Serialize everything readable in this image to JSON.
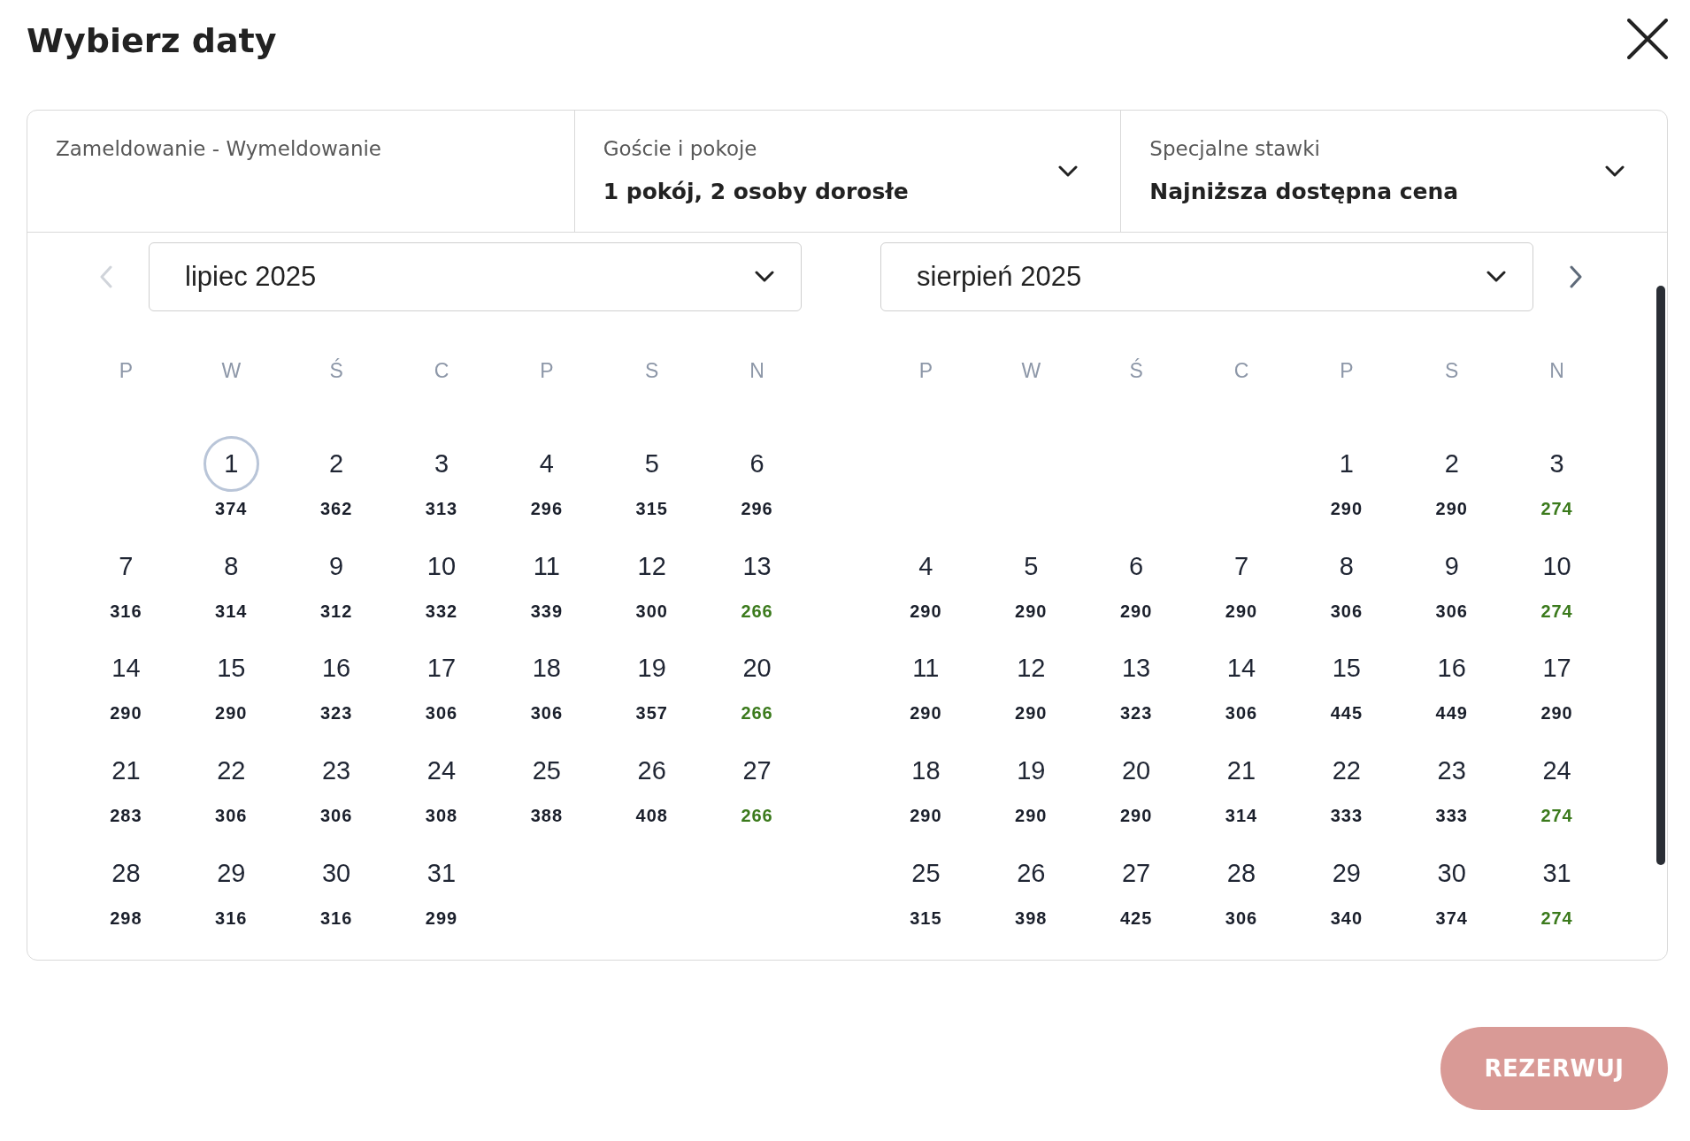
{
  "title": "Wybierz daty",
  "booking_fields": [
    {
      "kind": "text",
      "label": "Zameldowanie - Wymeldowanie"
    },
    {
      "kind": "dropdown",
      "label": "Goście i pokoje",
      "value": "1 pokój, 2 osoby dorosłe"
    },
    {
      "kind": "dropdown",
      "label": "Specjalne stawki",
      "value": "Najniższa dostępna cena"
    }
  ],
  "calendar": {
    "prev_button": {
      "disabled": true
    },
    "next_button": {
      "disabled": false
    },
    "months": [
      {
        "month_select": "lipiec 2025",
        "weekdays": [
          "P",
          "W",
          "Ś",
          "C",
          "P",
          "S",
          "N"
        ],
        "weeks": [
          [
            {
              "kind": "blank"
            },
            {
              "kind": "day",
              "day": "1",
              "price": "374",
              "today": true,
              "cheapest": false
            },
            {
              "kind": "day",
              "day": "2",
              "price": "362",
              "today": false,
              "cheapest": false
            },
            {
              "kind": "day",
              "day": "3",
              "price": "313",
              "today": false,
              "cheapest": false
            },
            {
              "kind": "day",
              "day": "4",
              "price": "296",
              "today": false,
              "cheapest": false
            },
            {
              "kind": "day",
              "day": "5",
              "price": "315",
              "today": false,
              "cheapest": false
            },
            {
              "kind": "day",
              "day": "6",
              "price": "296",
              "today": false,
              "cheapest": false
            }
          ],
          [
            {
              "kind": "day",
              "day": "7",
              "price": "316",
              "today": false,
              "cheapest": false
            },
            {
              "kind": "day",
              "day": "8",
              "price": "314",
              "today": false,
              "cheapest": false
            },
            {
              "kind": "day",
              "day": "9",
              "price": "312",
              "today": false,
              "cheapest": false
            },
            {
              "kind": "day",
              "day": "10",
              "price": "332",
              "today": false,
              "cheapest": false
            },
            {
              "kind": "day",
              "day": "11",
              "price": "339",
              "today": false,
              "cheapest": false
            },
            {
              "kind": "day",
              "day": "12",
              "price": "300",
              "today": false,
              "cheapest": false
            },
            {
              "kind": "day",
              "day": "13",
              "price": "266",
              "today": false,
              "cheapest": true
            }
          ],
          [
            {
              "kind": "day",
              "day": "14",
              "price": "290",
              "today": false,
              "cheapest": false
            },
            {
              "kind": "day",
              "day": "15",
              "price": "290",
              "today": false,
              "cheapest": false
            },
            {
              "kind": "day",
              "day": "16",
              "price": "323",
              "today": false,
              "cheapest": false
            },
            {
              "kind": "day",
              "day": "17",
              "price": "306",
              "today": false,
              "cheapest": false
            },
            {
              "kind": "day",
              "day": "18",
              "price": "306",
              "today": false,
              "cheapest": false
            },
            {
              "kind": "day",
              "day": "19",
              "price": "357",
              "today": false,
              "cheapest": false
            },
            {
              "kind": "day",
              "day": "20",
              "price": "266",
              "today": false,
              "cheapest": true
            }
          ],
          [
            {
              "kind": "day",
              "day": "21",
              "price": "283",
              "today": false,
              "cheapest": false
            },
            {
              "kind": "day",
              "day": "22",
              "price": "306",
              "today": false,
              "cheapest": false
            },
            {
              "kind": "day",
              "day": "23",
              "price": "306",
              "today": false,
              "cheapest": false
            },
            {
              "kind": "day",
              "day": "24",
              "price": "308",
              "today": false,
              "cheapest": false
            },
            {
              "kind": "day",
              "day": "25",
              "price": "388",
              "today": false,
              "cheapest": false
            },
            {
              "kind": "day",
              "day": "26",
              "price": "408",
              "today": false,
              "cheapest": false
            },
            {
              "kind": "day",
              "day": "27",
              "price": "266",
              "today": false,
              "cheapest": true
            }
          ],
          [
            {
              "kind": "day",
              "day": "28",
              "price": "298",
              "today": false,
              "cheapest": false
            },
            {
              "kind": "day",
              "day": "29",
              "price": "316",
              "today": false,
              "cheapest": false
            },
            {
              "kind": "day",
              "day": "30",
              "price": "316",
              "today": false,
              "cheapest": false
            },
            {
              "kind": "day",
              "day": "31",
              "price": "299",
              "today": false,
              "cheapest": false
            }
          ]
        ]
      },
      {
        "month_select": "sierpień 2025",
        "weekdays": [
          "P",
          "W",
          "Ś",
          "C",
          "P",
          "S",
          "N"
        ],
        "weeks": [
          [
            {
              "kind": "blank"
            },
            {
              "kind": "blank"
            },
            {
              "kind": "blank"
            },
            {
              "kind": "blank"
            },
            {
              "kind": "day",
              "day": "1",
              "price": "290",
              "today": false,
              "cheapest": false
            },
            {
              "kind": "day",
              "day": "2",
              "price": "290",
              "today": false,
              "cheapest": false
            },
            {
              "kind": "day",
              "day": "3",
              "price": "274",
              "today": false,
              "cheapest": true
            }
          ],
          [
            {
              "kind": "day",
              "day": "4",
              "price": "290",
              "today": false,
              "cheapest": false
            },
            {
              "kind": "day",
              "day": "5",
              "price": "290",
              "today": false,
              "cheapest": false
            },
            {
              "kind": "day",
              "day": "6",
              "price": "290",
              "today": false,
              "cheapest": false
            },
            {
              "kind": "day",
              "day": "7",
              "price": "290",
              "today": false,
              "cheapest": false
            },
            {
              "kind": "day",
              "day": "8",
              "price": "306",
              "today": false,
              "cheapest": false
            },
            {
              "kind": "day",
              "day": "9",
              "price": "306",
              "today": false,
              "cheapest": false
            },
            {
              "kind": "day",
              "day": "10",
              "price": "274",
              "today": false,
              "cheapest": true
            }
          ],
          [
            {
              "kind": "day",
              "day": "11",
              "price": "290",
              "today": false,
              "cheapest": false
            },
            {
              "kind": "day",
              "day": "12",
              "price": "290",
              "today": false,
              "cheapest": false
            },
            {
              "kind": "day",
              "day": "13",
              "price": "323",
              "today": false,
              "cheapest": false
            },
            {
              "kind": "day",
              "day": "14",
              "price": "306",
              "today": false,
              "cheapest": false
            },
            {
              "kind": "day",
              "day": "15",
              "price": "445",
              "today": false,
              "cheapest": false
            },
            {
              "kind": "day",
              "day": "16",
              "price": "449",
              "today": false,
              "cheapest": false
            },
            {
              "kind": "day",
              "day": "17",
              "price": "290",
              "today": false,
              "cheapest": false
            }
          ],
          [
            {
              "kind": "day",
              "day": "18",
              "price": "290",
              "today": false,
              "cheapest": false
            },
            {
              "kind": "day",
              "day": "19",
              "price": "290",
              "today": false,
              "cheapest": false
            },
            {
              "kind": "day",
              "day": "20",
              "price": "290",
              "today": false,
              "cheapest": false
            },
            {
              "kind": "day",
              "day": "21",
              "price": "314",
              "today": false,
              "cheapest": false
            },
            {
              "kind": "day",
              "day": "22",
              "price": "333",
              "today": false,
              "cheapest": false
            },
            {
              "kind": "day",
              "day": "23",
              "price": "333",
              "today": false,
              "cheapest": false
            },
            {
              "kind": "day",
              "day": "24",
              "price": "274",
              "today": false,
              "cheapest": true
            }
          ],
          [
            {
              "kind": "day",
              "day": "25",
              "price": "315",
              "today": false,
              "cheapest": false
            },
            {
              "kind": "day",
              "day": "26",
              "price": "398",
              "today": false,
              "cheapest": false
            },
            {
              "kind": "day",
              "day": "27",
              "price": "425",
              "today": false,
              "cheapest": false
            },
            {
              "kind": "day",
              "day": "28",
              "price": "306",
              "today": false,
              "cheapest": false
            },
            {
              "kind": "day",
              "day": "29",
              "price": "340",
              "today": false,
              "cheapest": false
            },
            {
              "kind": "day",
              "day": "30",
              "price": "374",
              "today": false,
              "cheapest": false
            },
            {
              "kind": "day",
              "day": "31",
              "price": "274",
              "today": false,
              "cheapest": true
            }
          ]
        ]
      }
    ]
  },
  "book_button": {
    "label": "REZERWUJ",
    "disabled": true
  }
}
